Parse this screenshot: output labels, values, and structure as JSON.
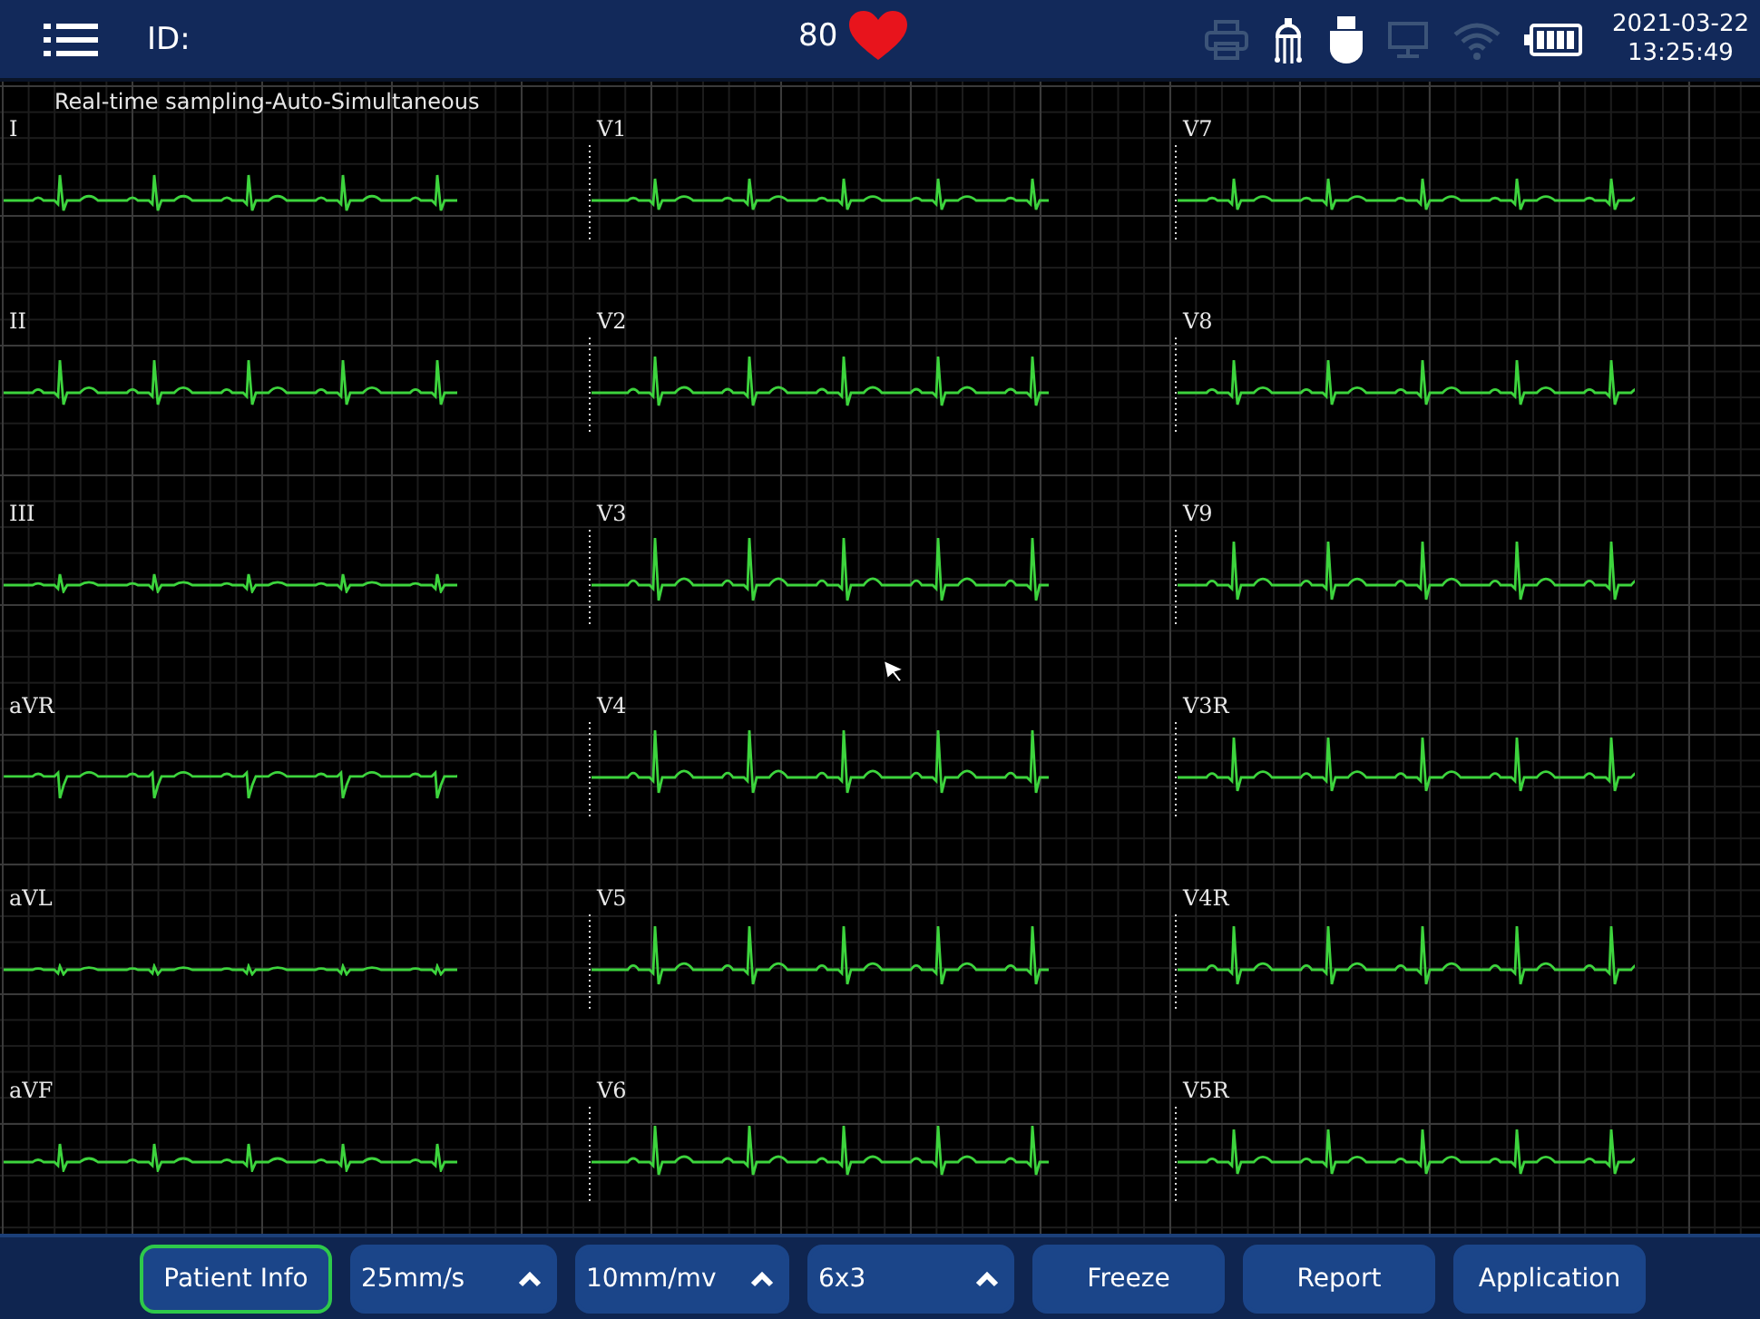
{
  "top_bar": {
    "id_label": "ID:",
    "heart_rate": "80",
    "date": "2021-03-22",
    "time": "13:25:49",
    "status_icons": [
      {
        "kind": "printer",
        "active": false
      },
      {
        "kind": "probe",
        "active": true
      },
      {
        "kind": "usb",
        "active": true
      },
      {
        "kind": "monitor",
        "active": false
      },
      {
        "kind": "wifi",
        "active": false
      },
      {
        "kind": "battery",
        "active": true
      }
    ]
  },
  "mode_title": "Real-time sampling-Auto-Simultaneous",
  "leads": [
    {
      "label": "I"
    },
    {
      "label": "V1"
    },
    {
      "label": "V7"
    },
    {
      "label": "II"
    },
    {
      "label": "V2"
    },
    {
      "label": "V8"
    },
    {
      "label": "III"
    },
    {
      "label": "V3"
    },
    {
      "label": "V9"
    },
    {
      "label": "aVR"
    },
    {
      "label": "V4"
    },
    {
      "label": "V3R"
    },
    {
      "label": "aVL"
    },
    {
      "label": "V5"
    },
    {
      "label": "V4R"
    },
    {
      "label": "aVF"
    },
    {
      "label": "V6"
    },
    {
      "label": "V5R"
    }
  ],
  "buttons": [
    {
      "kind": "button",
      "label": "Patient Info",
      "selected": true
    },
    {
      "kind": "dropdown",
      "label": "25mm/s",
      "selected": false
    },
    {
      "kind": "dropdown",
      "label": "10mm/mv",
      "selected": false
    },
    {
      "kind": "dropdown",
      "label": "6x3",
      "selected": false
    },
    {
      "kind": "button",
      "label": "Freeze",
      "selected": false
    },
    {
      "kind": "button",
      "label": "Report",
      "selected": false
    },
    {
      "kind": "button",
      "label": "Application",
      "selected": false
    }
  ]
}
